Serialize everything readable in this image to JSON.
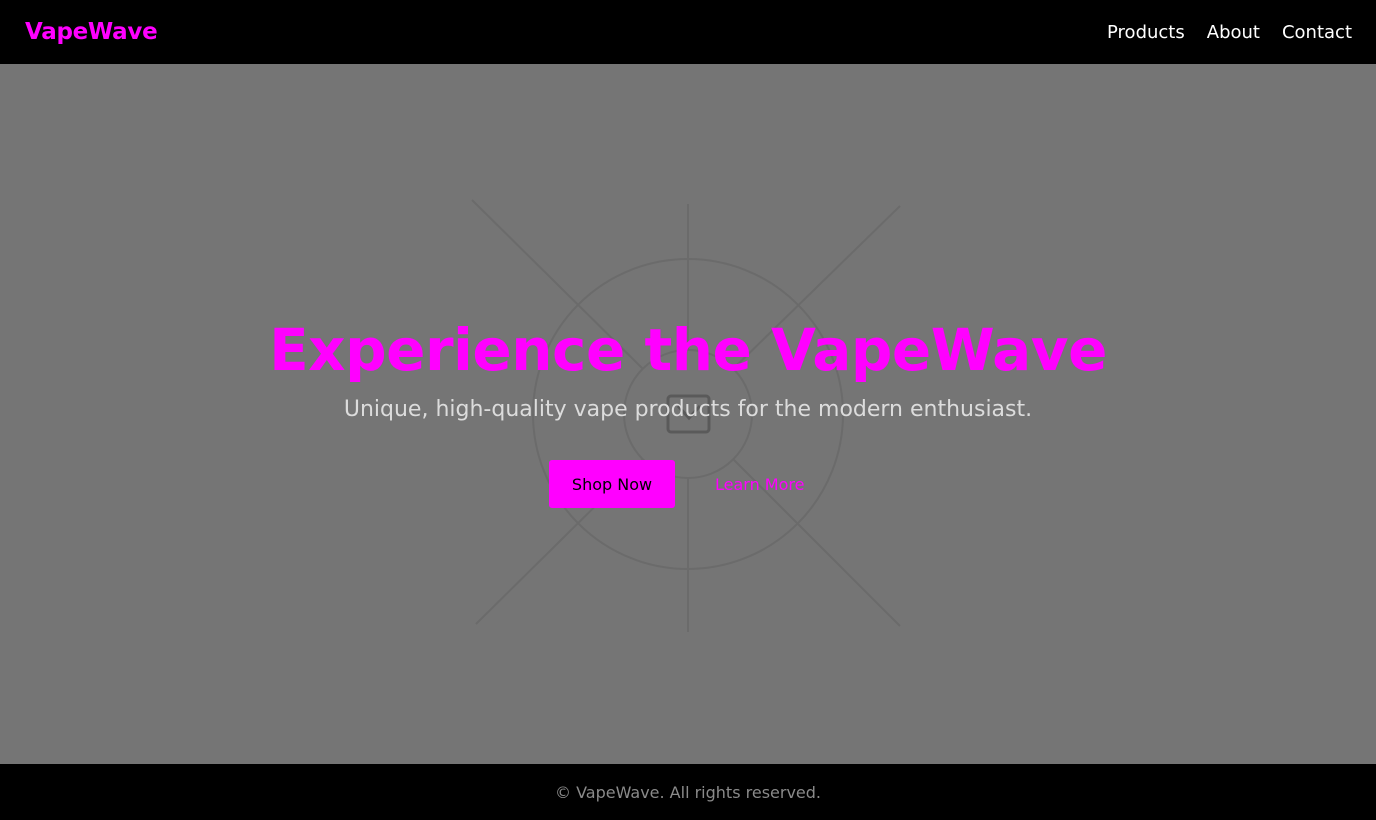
{
  "theme": {
    "accent": "#ff00ff",
    "nav_bg": "#000000",
    "hero_bg": "#757575",
    "footer_text": "#8a8a8a"
  },
  "header": {
    "brand": "VapeWave",
    "nav": [
      {
        "label": "Products"
      },
      {
        "label": "About"
      },
      {
        "label": "Contact"
      }
    ]
  },
  "hero": {
    "title": "Experience the VapeWave",
    "subtitle": "Unique, high-quality vape products for the modern enthusiast.",
    "primary_cta": "Shop Now",
    "secondary_cta": "Learn More",
    "background_icon": "broken-image-icon"
  },
  "footer": {
    "copyright": "© VapeWave. All rights reserved."
  }
}
